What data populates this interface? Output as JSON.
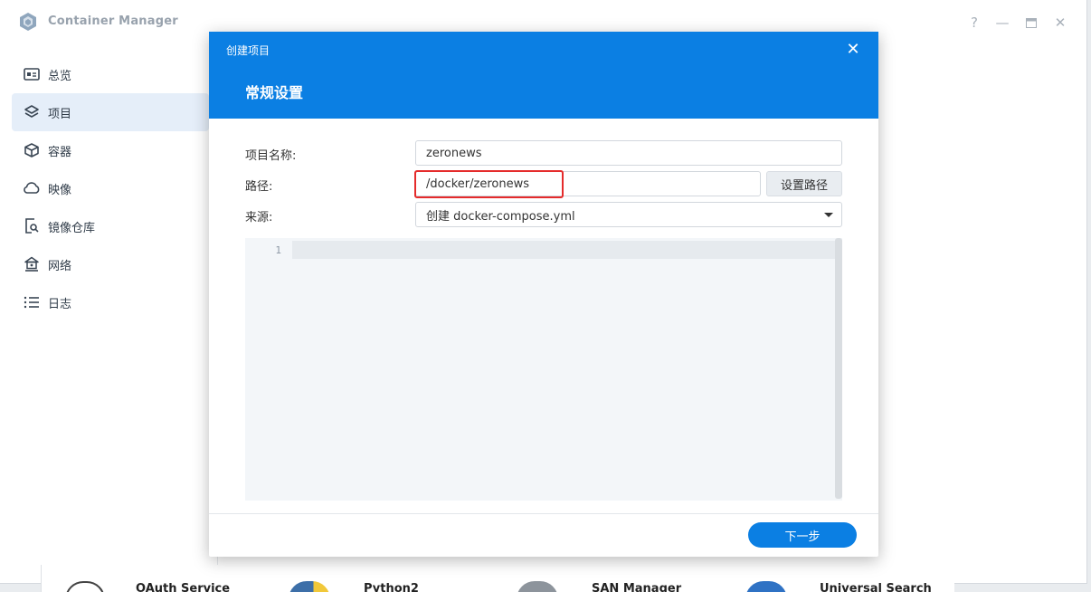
{
  "app": {
    "title": "Container Manager",
    "controls": {
      "help": "?",
      "minimize": "—",
      "maximize": "▭",
      "close": "✕"
    }
  },
  "sidebar": {
    "items": [
      {
        "label": "总览",
        "icon": "overview-icon",
        "active": false
      },
      {
        "label": "项目",
        "icon": "layers-icon",
        "active": true
      },
      {
        "label": "容器",
        "icon": "cube-icon",
        "active": false
      },
      {
        "label": "映像",
        "icon": "cloud-icon",
        "active": false
      },
      {
        "label": "镜像仓库",
        "icon": "registry-search-icon",
        "active": false
      },
      {
        "label": "网络",
        "icon": "network-icon",
        "active": false
      },
      {
        "label": "日志",
        "icon": "list-icon",
        "active": false
      }
    ]
  },
  "background_packages": [
    "OAuth Service",
    "Python2",
    "SAN Manager",
    "Universal Search"
  ],
  "dialog": {
    "title": "创建项目",
    "close": "✕",
    "subtitle": "常规设置",
    "fields": {
      "name_label": "项目名称:",
      "name_value": "zeronews",
      "path_label": "路径:",
      "path_value": "/docker/zeronews",
      "set_path_button": "设置路径",
      "source_label": "来源:",
      "source_value": "创建 docker-compose.yml"
    },
    "editor": {
      "line_numbers": [
        "1"
      ]
    },
    "next_button": "下一步"
  },
  "colors": {
    "accent": "#0b7fe3",
    "highlight": "#e52b2b",
    "sidebar_active": "#e5eef9"
  }
}
